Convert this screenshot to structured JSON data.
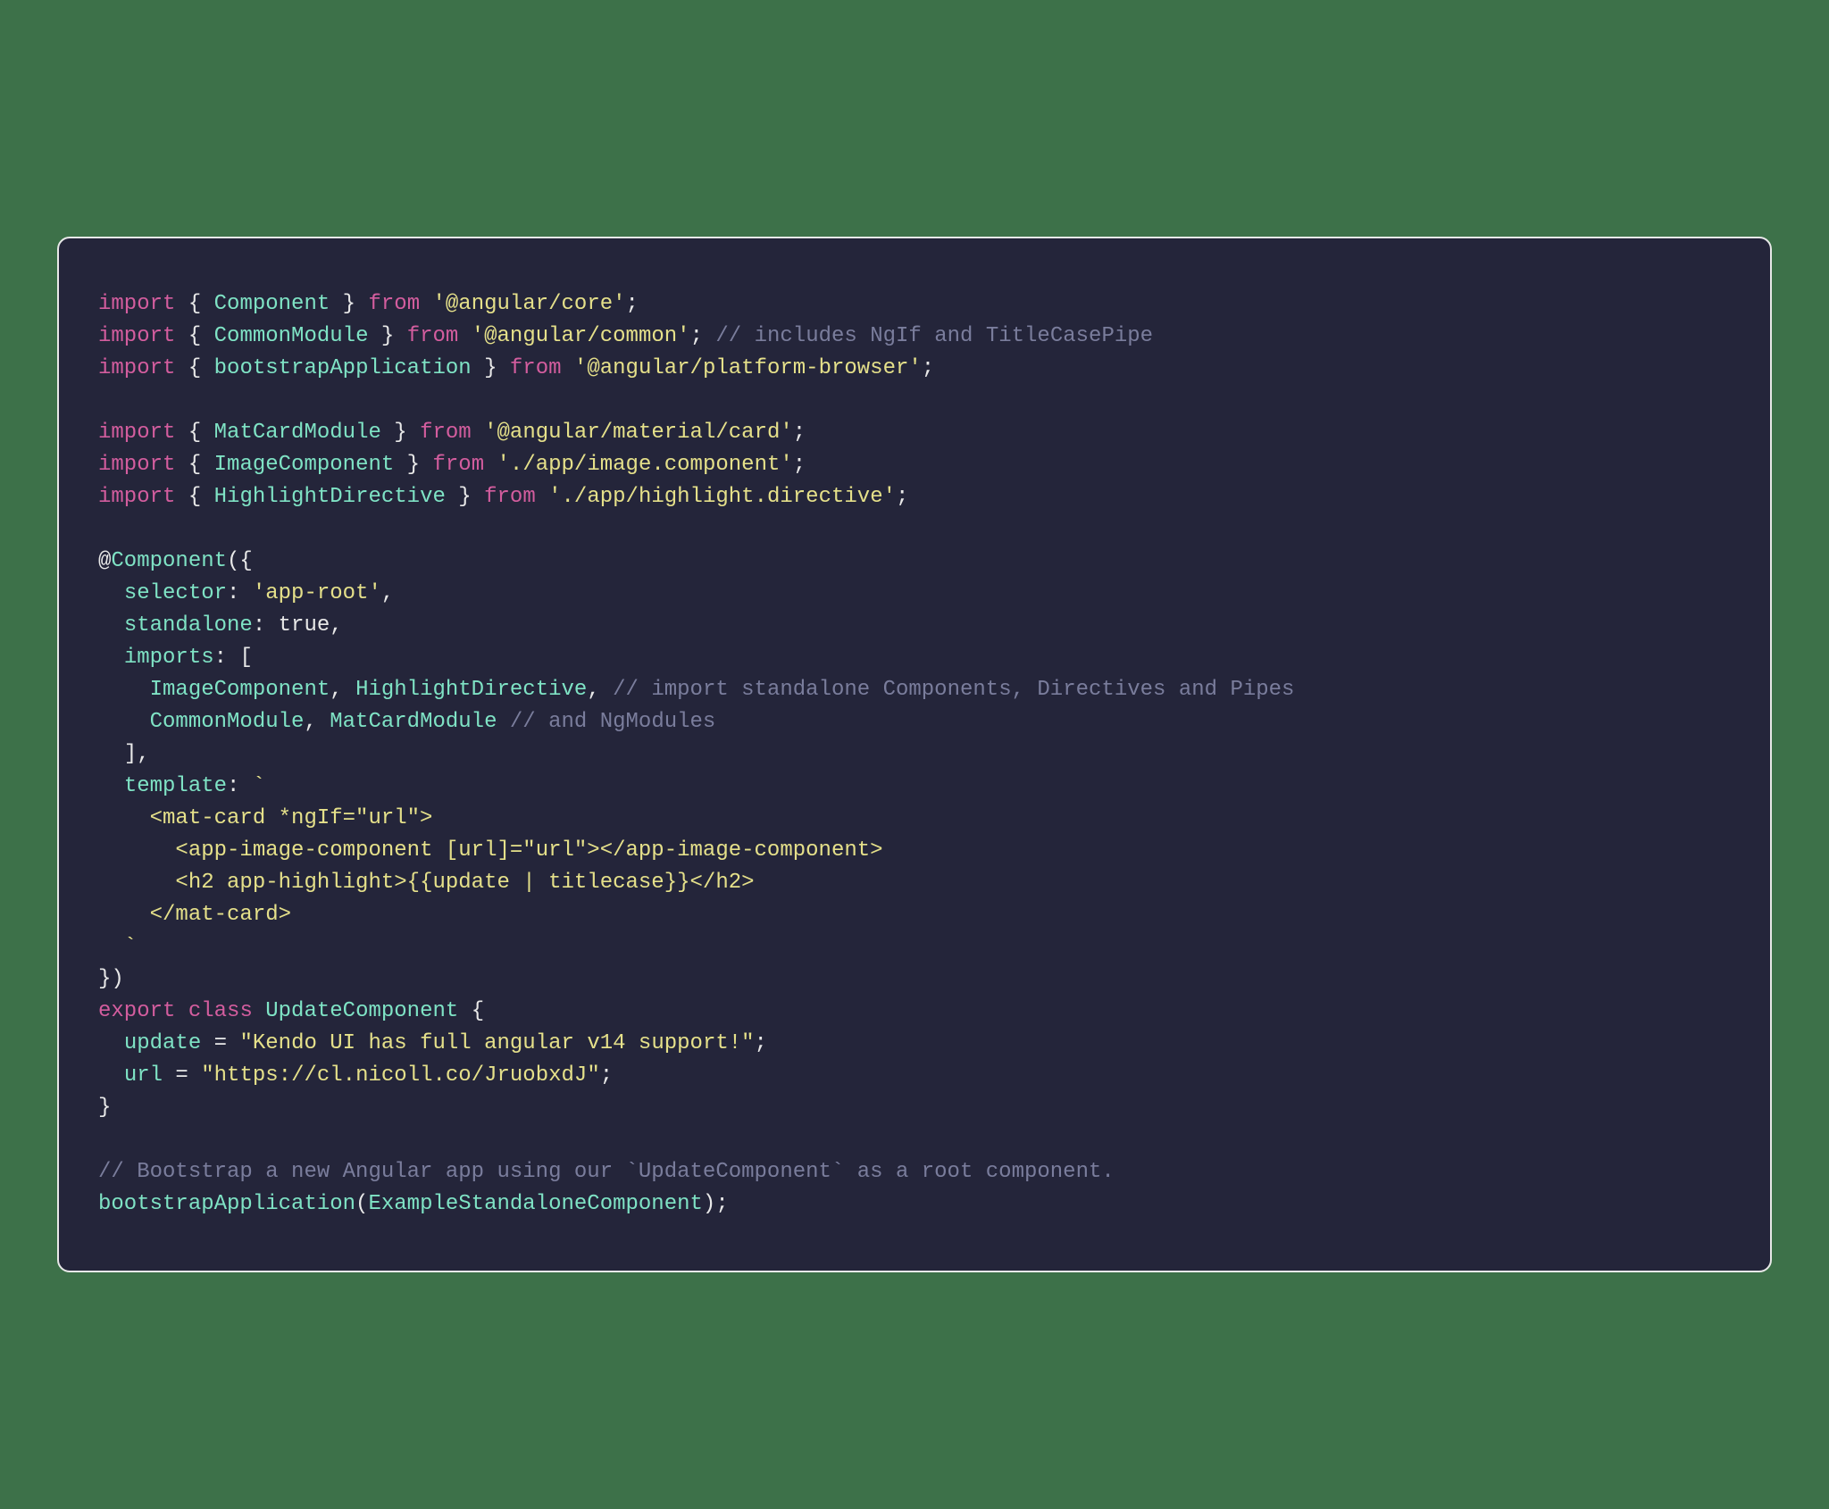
{
  "code": {
    "imports": [
      {
        "what": "Component",
        "from": "@angular/core",
        "comment": ""
      },
      {
        "what": "CommonModule",
        "from": "@angular/common",
        "comment": "// includes NgIf and TitleCasePipe"
      },
      {
        "what": "bootstrapApplication",
        "from": "@angular/platform-browser",
        "comment": ""
      },
      {
        "what": "MatCardModule",
        "from": "@angular/material/card",
        "comment": ""
      },
      {
        "what": "ImageComponent",
        "from": "./app/image.component",
        "comment": ""
      },
      {
        "what": "HighlightDirective",
        "from": "./app/highlight.directive",
        "comment": ""
      }
    ],
    "decorator": {
      "name": "Component",
      "props": {
        "selector": "app-root",
        "standalone": "true",
        "imports_line1_a": "ImageComponent",
        "imports_line1_b": "HighlightDirective",
        "imports_line1_comment": "// import standalone Components, Directives and Pipes",
        "imports_line2_a": "CommonModule",
        "imports_line2_b": "MatCardModule",
        "imports_line2_comment": "// and NgModules",
        "template_l1": "    <mat-card *ngIf=\"url\">",
        "template_l2": "      <app-image-component [url]=\"url\"></app-image-component>",
        "template_l3": "      <h2 app-highlight>{{update | titlecase}}</h2>",
        "template_l4": "    </mat-card>"
      }
    },
    "class": {
      "keyword_export": "export",
      "keyword_class": "class",
      "name": "UpdateComponent",
      "field1_name": "update",
      "field1_value": "\"Kendo UI has full angular v14 support!\"",
      "field2_name": "url",
      "field2_value": "\"https://cl.nicoll.co/JruobxdJ\""
    },
    "bootstrap": {
      "comment": "// Bootstrap a new Angular app using our `UpdateComponent` as a root component.",
      "fn": "bootstrapApplication",
      "arg": "ExampleStandaloneComponent"
    }
  }
}
